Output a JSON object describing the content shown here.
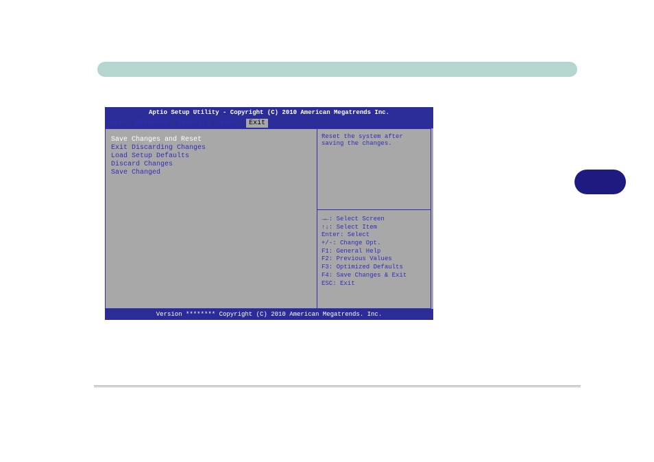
{
  "bios": {
    "header": "Aptio Setup Utility - Copyright (C) 2010 American Megatrends Inc.",
    "footer": "Version ******** Copyright (C) 2010 American Megatrends. Inc.",
    "tabs": {
      "main": "Main",
      "advanced": "Advanced",
      "security": "Security",
      "boot": "Boot",
      "exit": "Exit"
    },
    "items": {
      "save_reset": "Save Changes and Reset",
      "exit_discard": "Exit Discarding Changes",
      "load_defaults": "Load Setup Defaults",
      "discard": "Discard Changes",
      "save_changed": "Save Changed"
    },
    "description": "Reset the system after saving the changes.",
    "help": {
      "select_screen": ": Select Screen",
      "select_item": ": Select Item",
      "enter": "Enter: Select",
      "change": "+/-: Change Opt.",
      "f1": "F1: General Help",
      "f2": "F2: Previous Values",
      "f3": "F3: Optimized Defaults",
      "f4": "F4: Save Changes & Exit",
      "esc": "ESC: Exit"
    }
  }
}
